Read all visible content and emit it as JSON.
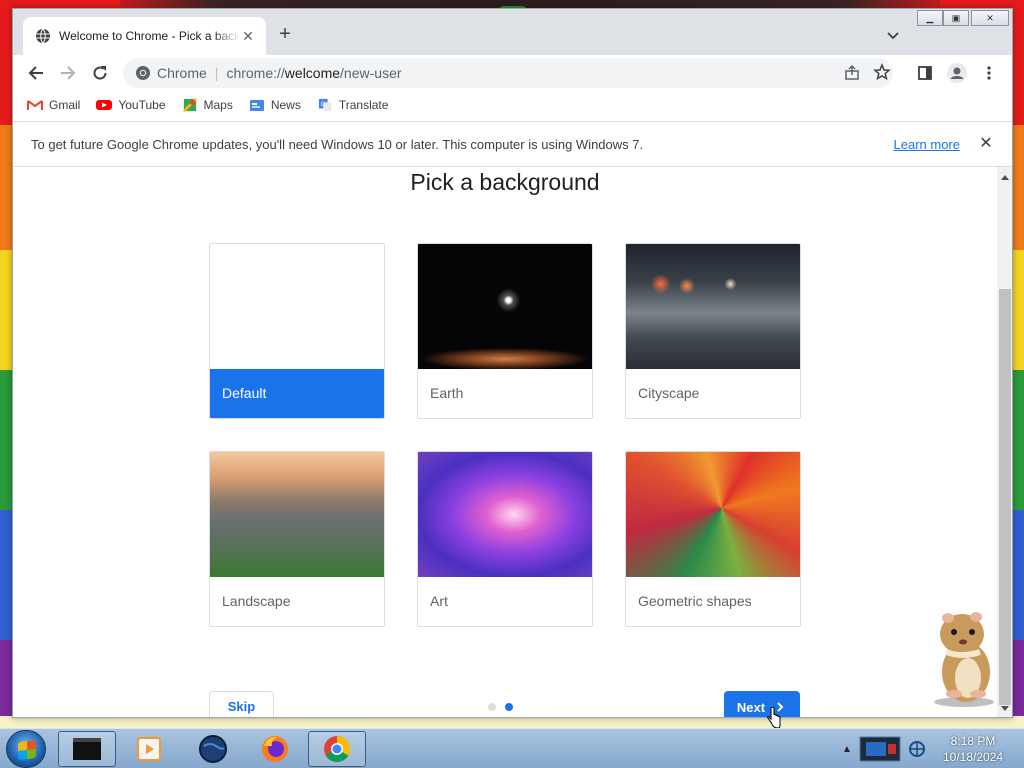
{
  "window": {
    "tab_title": "Welcome to Chrome - Pick a background",
    "controls": [
      "minimize",
      "maximize",
      "close"
    ]
  },
  "toolbar": {
    "site_name": "Chrome",
    "url_scheme": "chrome://",
    "url_host": "welcome",
    "url_path": "/new-user"
  },
  "bookmarks": [
    {
      "label": "Gmail",
      "icon": "gmail-icon"
    },
    {
      "label": "YouTube",
      "icon": "youtube-icon"
    },
    {
      "label": "Maps",
      "icon": "maps-icon"
    },
    {
      "label": "News",
      "icon": "news-icon"
    },
    {
      "label": "Translate",
      "icon": "translate-icon"
    }
  ],
  "infobar": {
    "message": "To get future Google Chrome updates, you'll need Windows 10 or later. This computer is using Windows 7.",
    "link": "Learn more"
  },
  "page": {
    "heading": "Pick a background",
    "backgrounds": [
      {
        "label": "Default",
        "selected": true
      },
      {
        "label": "Earth",
        "selected": false
      },
      {
        "label": "Cityscape",
        "selected": false
      },
      {
        "label": "Landscape",
        "selected": false
      },
      {
        "label": "Art",
        "selected": false
      },
      {
        "label": "Geometric shapes",
        "selected": false
      }
    ],
    "skip_label": "Skip",
    "next_label": "Next",
    "step_current": 2,
    "step_total": 2
  },
  "taskbar": {
    "apps": [
      "command-window",
      "media-player",
      "globe-app",
      "firefox",
      "chrome"
    ],
    "time": "8:18 PM",
    "date": "10/18/2024"
  },
  "colors": {
    "accent": "#1a73e8",
    "tabstrip": "#dee1e6"
  }
}
